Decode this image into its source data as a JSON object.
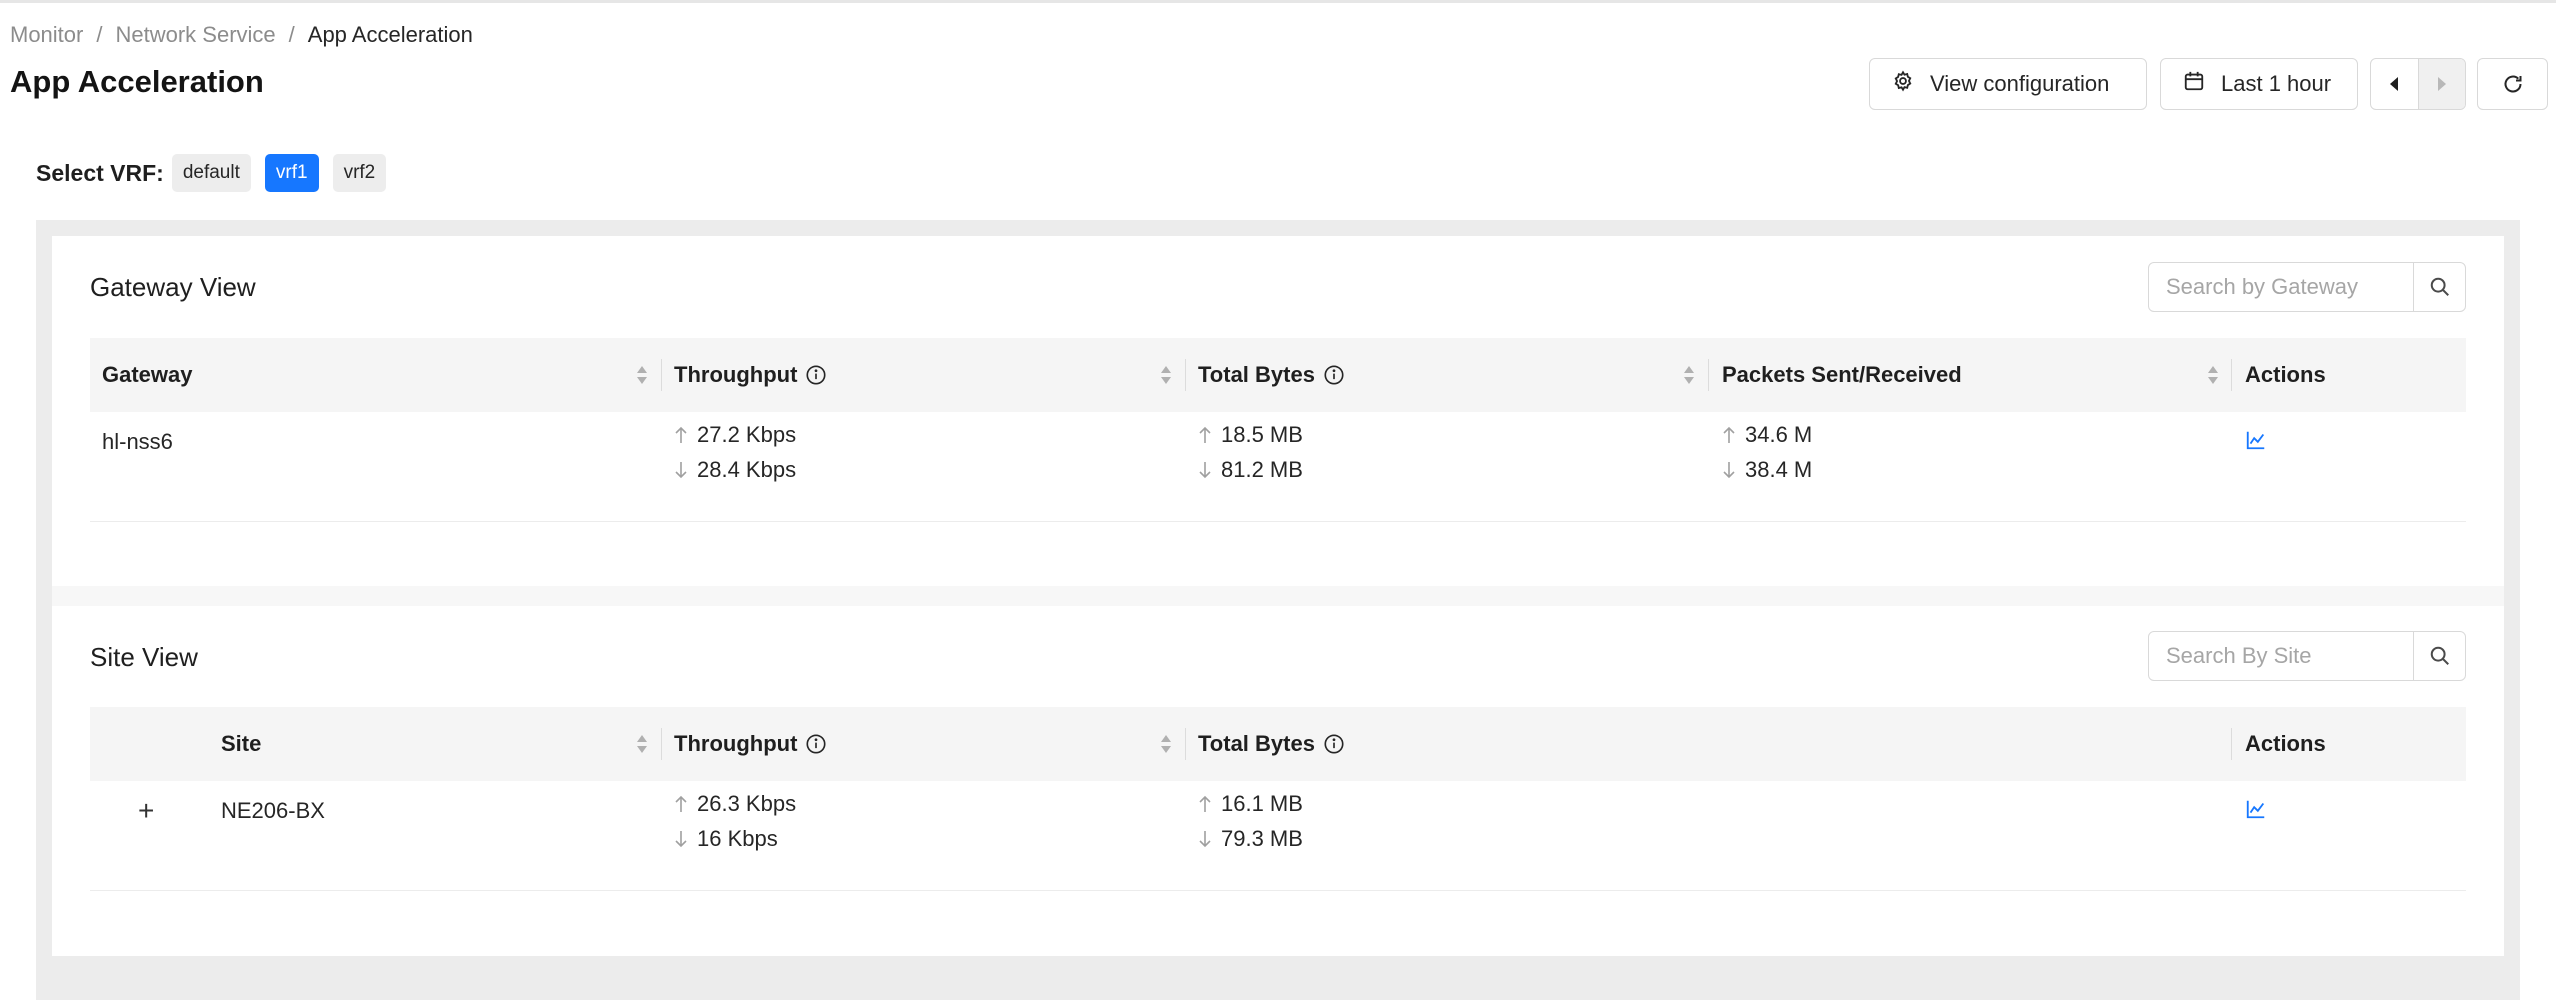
{
  "breadcrumb": {
    "items": [
      "Monitor",
      "Network Service"
    ],
    "current": "App Acceleration"
  },
  "page_title": "App Acceleration",
  "toolbar": {
    "config_label": "View configuration",
    "time_label": "Last 1 hour"
  },
  "vrf": {
    "label": "Select VRF:",
    "options": [
      "default",
      "vrf1",
      "vrf2"
    ],
    "selected": "vrf1"
  },
  "gateway_view": {
    "title": "Gateway View",
    "search_placeholder": "Search by Gateway",
    "columns": [
      "Gateway",
      "Throughput",
      "Total Bytes",
      "Packets Sent/Received",
      "Actions"
    ],
    "rows": [
      {
        "gateway": "hl-nss6",
        "throughput_up": "27.2 Kbps",
        "throughput_down": "28.4 Kbps",
        "bytes_up": "18.5 MB",
        "bytes_down": "81.2 MB",
        "packets_up": "34.6 M",
        "packets_down": "38.4 M"
      }
    ]
  },
  "site_view": {
    "title": "Site View",
    "search_placeholder": "Search By Site",
    "columns": [
      "Site",
      "Throughput",
      "Total Bytes",
      "Actions"
    ],
    "rows": [
      {
        "expand": "+",
        "site": "NE206-BX",
        "throughput_up": "26.3 Kbps",
        "throughput_down": "16 Kbps",
        "bytes_up": "16.1 MB",
        "bytes_down": "79.3 MB"
      }
    ]
  },
  "colors": {
    "accent": "#1677ff",
    "panel_bg": "#ececec",
    "header_bg": "#f5f5f5"
  }
}
